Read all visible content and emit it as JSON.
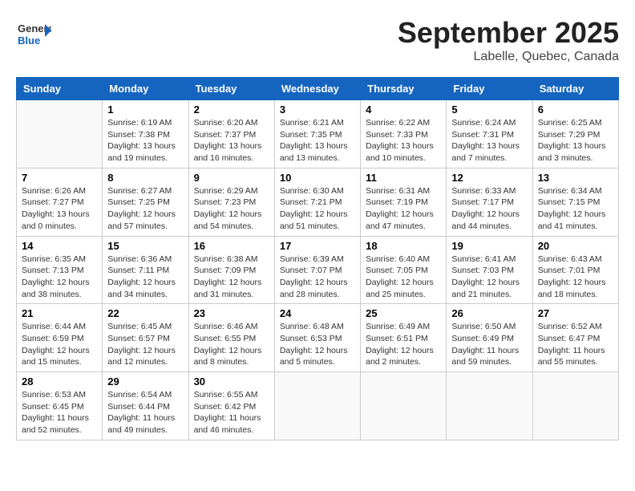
{
  "logo": {
    "general": "General",
    "blue": "Blue"
  },
  "header": {
    "month": "September 2025",
    "location": "Labelle, Quebec, Canada"
  },
  "weekdays": [
    "Sunday",
    "Monday",
    "Tuesday",
    "Wednesday",
    "Thursday",
    "Friday",
    "Saturday"
  ],
  "weeks": [
    [
      {
        "day": "",
        "info": ""
      },
      {
        "day": "1",
        "info": "Sunrise: 6:19 AM\nSunset: 7:38 PM\nDaylight: 13 hours\nand 19 minutes."
      },
      {
        "day": "2",
        "info": "Sunrise: 6:20 AM\nSunset: 7:37 PM\nDaylight: 13 hours\nand 16 minutes."
      },
      {
        "day": "3",
        "info": "Sunrise: 6:21 AM\nSunset: 7:35 PM\nDaylight: 13 hours\nand 13 minutes."
      },
      {
        "day": "4",
        "info": "Sunrise: 6:22 AM\nSunset: 7:33 PM\nDaylight: 13 hours\nand 10 minutes."
      },
      {
        "day": "5",
        "info": "Sunrise: 6:24 AM\nSunset: 7:31 PM\nDaylight: 13 hours\nand 7 minutes."
      },
      {
        "day": "6",
        "info": "Sunrise: 6:25 AM\nSunset: 7:29 PM\nDaylight: 13 hours\nand 3 minutes."
      }
    ],
    [
      {
        "day": "7",
        "info": "Sunrise: 6:26 AM\nSunset: 7:27 PM\nDaylight: 13 hours\nand 0 minutes."
      },
      {
        "day": "8",
        "info": "Sunrise: 6:27 AM\nSunset: 7:25 PM\nDaylight: 12 hours\nand 57 minutes."
      },
      {
        "day": "9",
        "info": "Sunrise: 6:29 AM\nSunset: 7:23 PM\nDaylight: 12 hours\nand 54 minutes."
      },
      {
        "day": "10",
        "info": "Sunrise: 6:30 AM\nSunset: 7:21 PM\nDaylight: 12 hours\nand 51 minutes."
      },
      {
        "day": "11",
        "info": "Sunrise: 6:31 AM\nSunset: 7:19 PM\nDaylight: 12 hours\nand 47 minutes."
      },
      {
        "day": "12",
        "info": "Sunrise: 6:33 AM\nSunset: 7:17 PM\nDaylight: 12 hours\nand 44 minutes."
      },
      {
        "day": "13",
        "info": "Sunrise: 6:34 AM\nSunset: 7:15 PM\nDaylight: 12 hours\nand 41 minutes."
      }
    ],
    [
      {
        "day": "14",
        "info": "Sunrise: 6:35 AM\nSunset: 7:13 PM\nDaylight: 12 hours\nand 38 minutes."
      },
      {
        "day": "15",
        "info": "Sunrise: 6:36 AM\nSunset: 7:11 PM\nDaylight: 12 hours\nand 34 minutes."
      },
      {
        "day": "16",
        "info": "Sunrise: 6:38 AM\nSunset: 7:09 PM\nDaylight: 12 hours\nand 31 minutes."
      },
      {
        "day": "17",
        "info": "Sunrise: 6:39 AM\nSunset: 7:07 PM\nDaylight: 12 hours\nand 28 minutes."
      },
      {
        "day": "18",
        "info": "Sunrise: 6:40 AM\nSunset: 7:05 PM\nDaylight: 12 hours\nand 25 minutes."
      },
      {
        "day": "19",
        "info": "Sunrise: 6:41 AM\nSunset: 7:03 PM\nDaylight: 12 hours\nand 21 minutes."
      },
      {
        "day": "20",
        "info": "Sunrise: 6:43 AM\nSunset: 7:01 PM\nDaylight: 12 hours\nand 18 minutes."
      }
    ],
    [
      {
        "day": "21",
        "info": "Sunrise: 6:44 AM\nSunset: 6:59 PM\nDaylight: 12 hours\nand 15 minutes."
      },
      {
        "day": "22",
        "info": "Sunrise: 6:45 AM\nSunset: 6:57 PM\nDaylight: 12 hours\nand 12 minutes."
      },
      {
        "day": "23",
        "info": "Sunrise: 6:46 AM\nSunset: 6:55 PM\nDaylight: 12 hours\nand 8 minutes."
      },
      {
        "day": "24",
        "info": "Sunrise: 6:48 AM\nSunset: 6:53 PM\nDaylight: 12 hours\nand 5 minutes."
      },
      {
        "day": "25",
        "info": "Sunrise: 6:49 AM\nSunset: 6:51 PM\nDaylight: 12 hours\nand 2 minutes."
      },
      {
        "day": "26",
        "info": "Sunrise: 6:50 AM\nSunset: 6:49 PM\nDaylight: 11 hours\nand 59 minutes."
      },
      {
        "day": "27",
        "info": "Sunrise: 6:52 AM\nSunset: 6:47 PM\nDaylight: 11 hours\nand 55 minutes."
      }
    ],
    [
      {
        "day": "28",
        "info": "Sunrise: 6:53 AM\nSunset: 6:45 PM\nDaylight: 11 hours\nand 52 minutes."
      },
      {
        "day": "29",
        "info": "Sunrise: 6:54 AM\nSunset: 6:44 PM\nDaylight: 11 hours\nand 49 minutes."
      },
      {
        "day": "30",
        "info": "Sunrise: 6:55 AM\nSunset: 6:42 PM\nDaylight: 11 hours\nand 46 minutes."
      },
      {
        "day": "",
        "info": ""
      },
      {
        "day": "",
        "info": ""
      },
      {
        "day": "",
        "info": ""
      },
      {
        "day": "",
        "info": ""
      }
    ]
  ]
}
